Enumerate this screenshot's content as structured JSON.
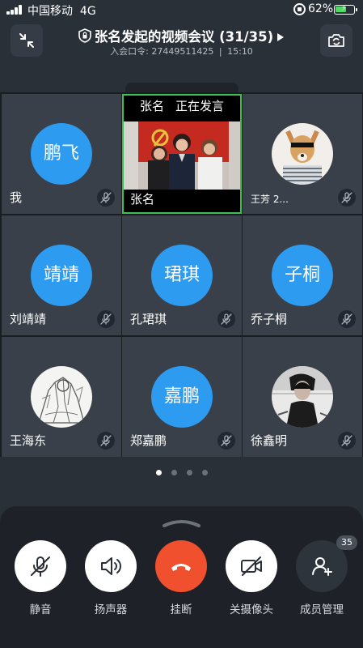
{
  "status_bar": {
    "carrier": "中国移动",
    "network": "4G",
    "battery_percent": "62%",
    "battery_level": 0.62,
    "icons": [
      "signal-bars-icon",
      "rotation-lock-icon",
      "battery-charging-icon"
    ]
  },
  "header": {
    "title": "张名发起的视频会议 (31/35)",
    "meeting_code_label": "入会口令:",
    "meeting_code": "27449511425",
    "time": "15:10"
  },
  "speaker_tile": {
    "speaker_name": "张名",
    "speaking_text": "正在发言",
    "name": "张名"
  },
  "participants": [
    {
      "avatar_text": "鹏飞",
      "name": "我"
    },
    {
      "avatar_text": "",
      "name": "王芳 2..."
    },
    {
      "avatar_text": "靖靖",
      "name": "刘靖靖"
    },
    {
      "avatar_text": "珺琪",
      "name": "孔珺琪"
    },
    {
      "avatar_text": "子桐",
      "name": "乔子桐"
    },
    {
      "avatar_text": "",
      "name": "王海东"
    },
    {
      "avatar_text": "嘉鹏",
      "name": "郑嘉鹏"
    },
    {
      "avatar_text": "",
      "name": "徐鑫明"
    }
  ],
  "pagination": {
    "total_pages": 4,
    "current_page": 1
  },
  "controls": {
    "mute_label": "静音",
    "speaker_label": "扬声器",
    "hangup_label": "挂断",
    "camera_label": "关摄像头",
    "members_label": "成员管理",
    "members_count": "35"
  },
  "colors": {
    "background": "#2a3038",
    "tile": "#3a4049",
    "avatar_blue": "#2d9bf0",
    "active_speaker_border": "#3fbf4f",
    "hangup_red": "#f0502d",
    "battery_green": "#4cd964"
  }
}
